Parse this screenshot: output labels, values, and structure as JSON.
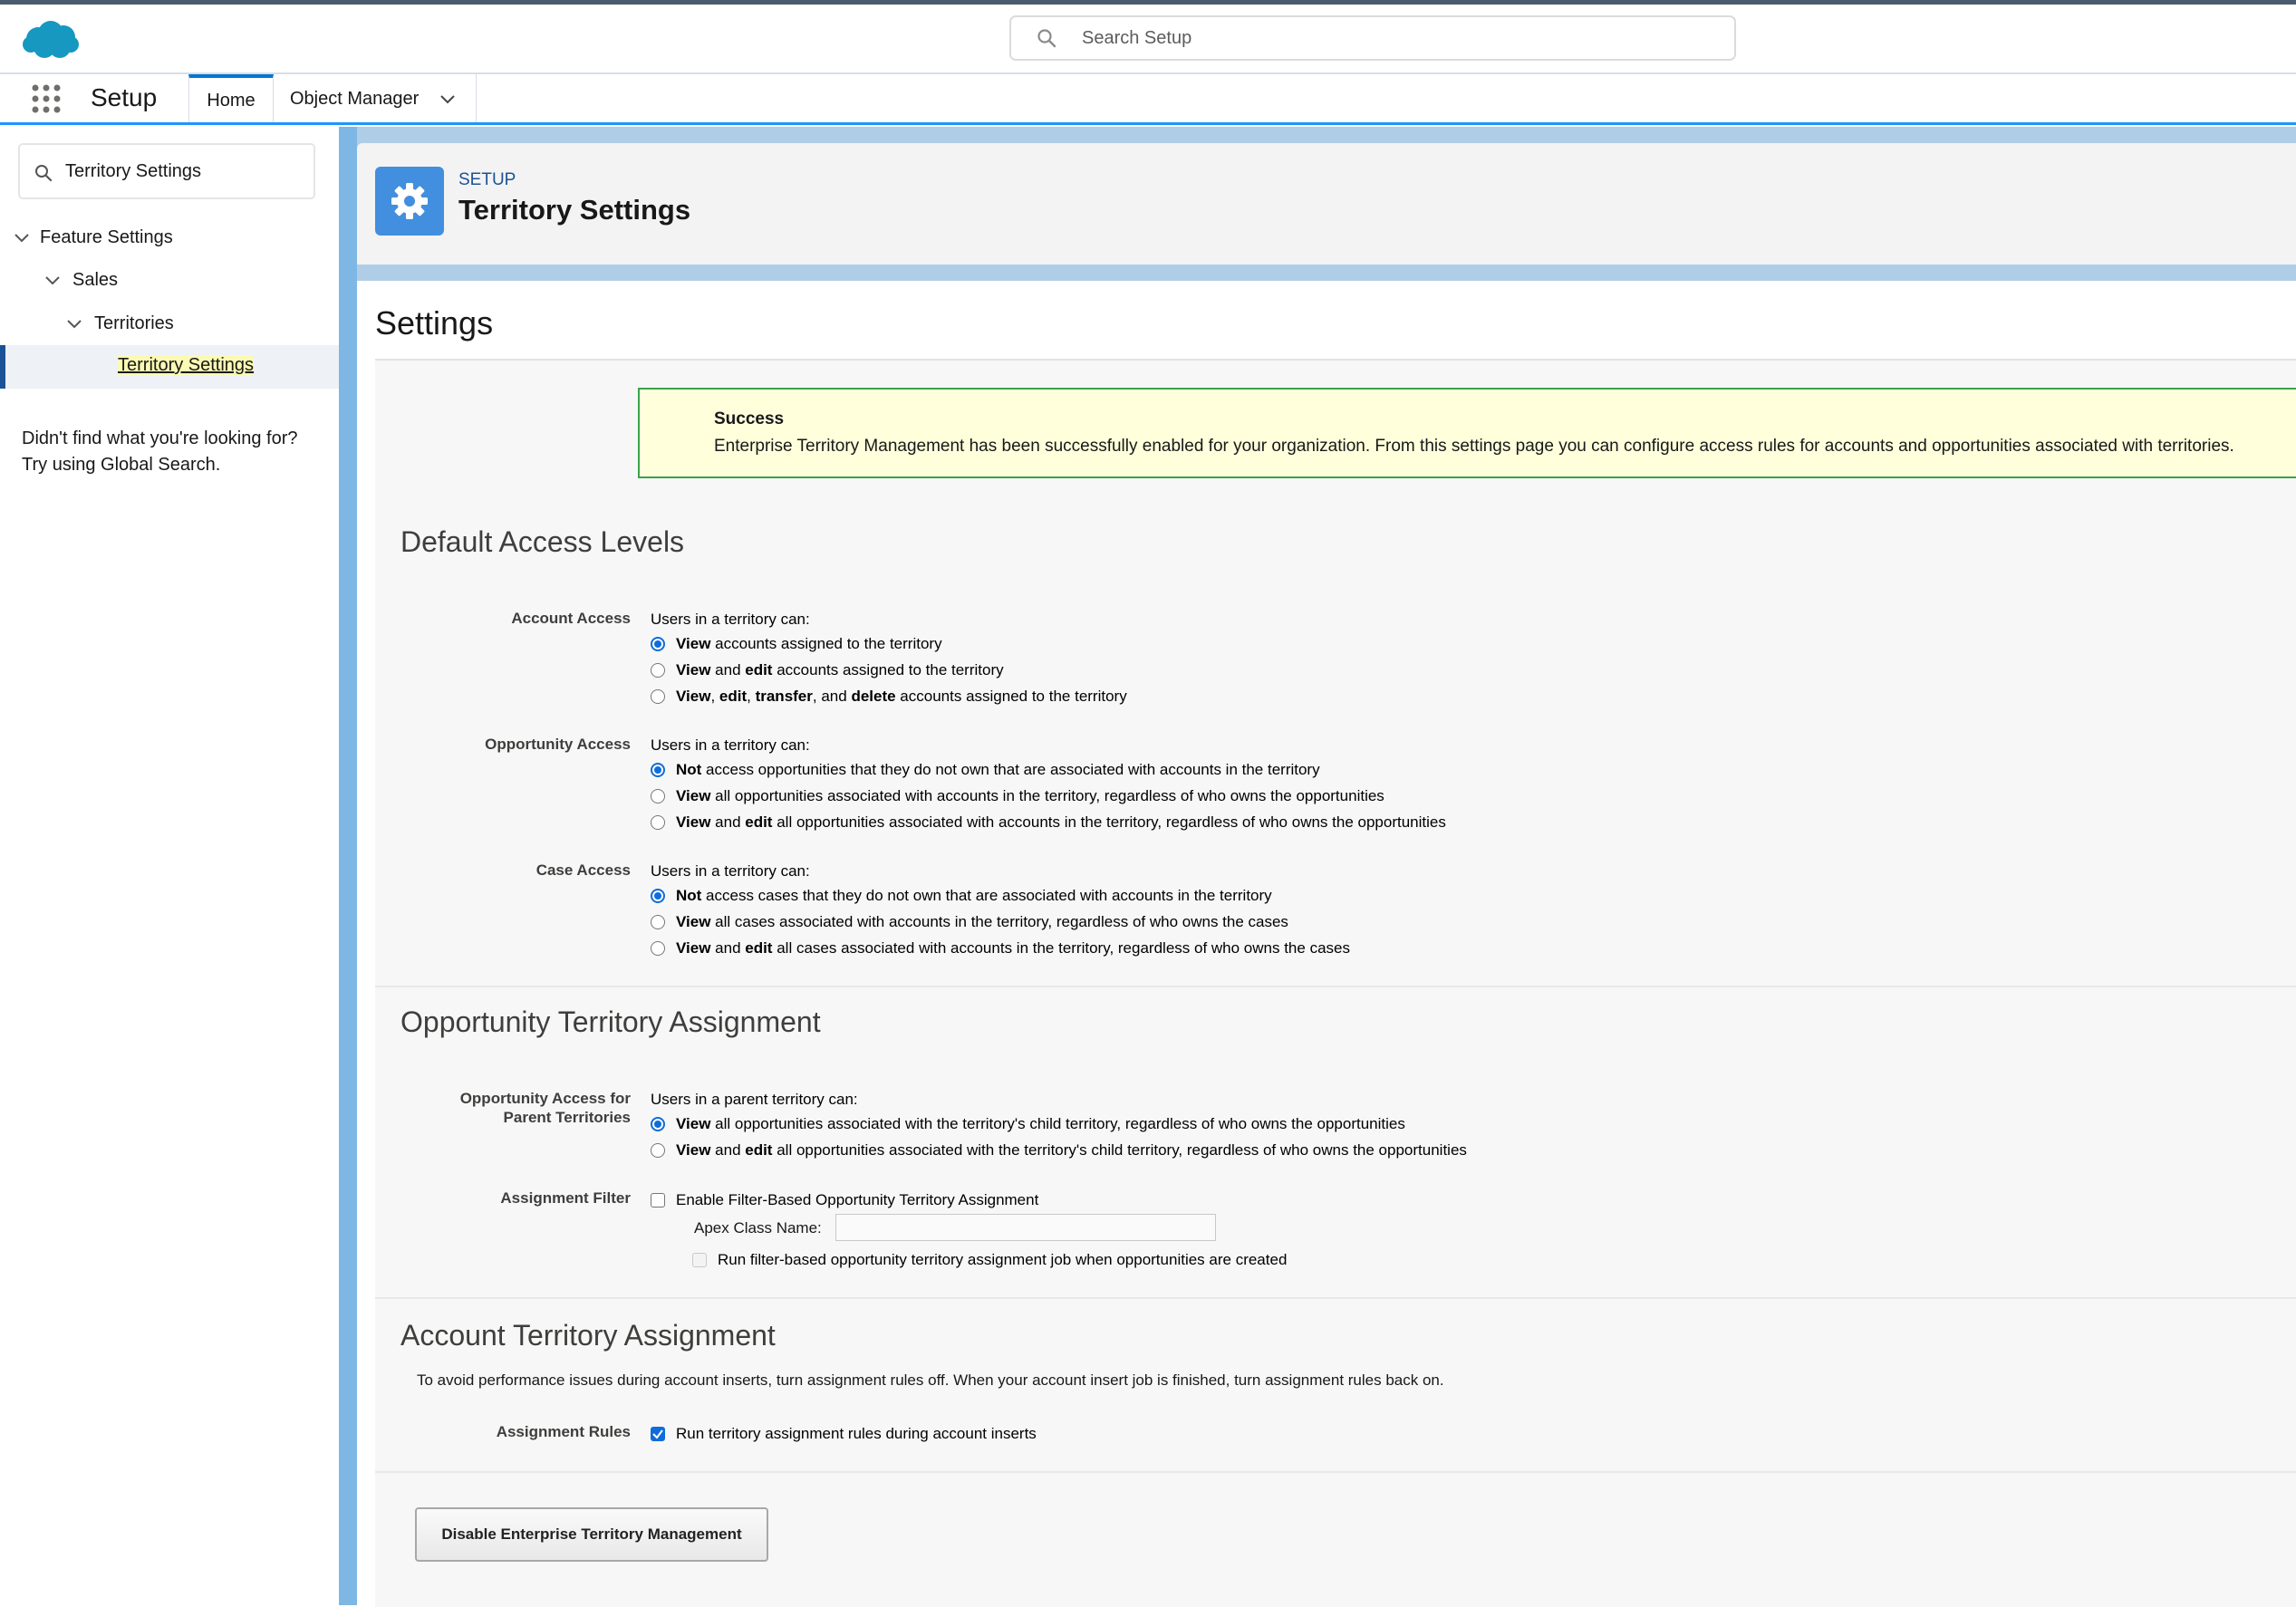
{
  "header": {
    "search_placeholder": "Search Setup"
  },
  "nav": {
    "app_name": "Setup",
    "tabs": [
      {
        "label": "Home"
      },
      {
        "label": "Object Manager"
      }
    ]
  },
  "sidebar": {
    "search_value": "Territory Settings",
    "tree": [
      {
        "label": "Feature Settings"
      },
      {
        "label": "Sales"
      },
      {
        "label": "Territories"
      },
      {
        "label": "Territory Settings"
      }
    ],
    "help_line1": "Didn't find what you're looking for?",
    "help_line2": "Try using Global Search."
  },
  "page_header": {
    "eyebrow": "SETUP",
    "title": "Territory Settings"
  },
  "settings_title": "Settings",
  "success": {
    "title": "Success",
    "message": "Enterprise Territory Management has been successfully enabled for your organization. From this settings page you can configure access rules for accounts and opportunities associated with territories."
  },
  "default_access": {
    "heading": "Default Access Levels",
    "account": {
      "label": "Account Access",
      "intro": "Users in a territory can:"
    },
    "opportunity": {
      "label": "Opportunity Access",
      "intro": "Users in a territory can:"
    },
    "case": {
      "label": "Case Access",
      "intro": "Users in a territory can:"
    }
  },
  "opp_assignment": {
    "heading": "Opportunity Territory Assignment",
    "parent_label_line1": "Opportunity Access for",
    "parent_label_line2": "Parent Territories",
    "parent_intro": "Users in a parent territory can:",
    "filter_label": "Assignment Filter",
    "filter_checkbox": "Enable Filter-Based Opportunity Territory Assignment",
    "apex_label": "Apex Class Name:",
    "apex_value": "",
    "run_job_checkbox": "Run filter-based opportunity territory assignment job when opportunities are created"
  },
  "account_assignment": {
    "heading": "Account Territory Assignment",
    "note": "To avoid performance issues during account inserts, turn assignment rules off. When your account insert job is finished, turn assignment rules back on.",
    "rules_label": "Assignment Rules",
    "rules_checkbox": "Run territory assignment rules during account inserts"
  },
  "disable_button": "Disable Enterprise Territory Management",
  "colors": {
    "brand_blue": "#0176d3",
    "icon_blue": "#418fde",
    "success_border": "#39a34a",
    "success_bg": "#ffffdc"
  }
}
